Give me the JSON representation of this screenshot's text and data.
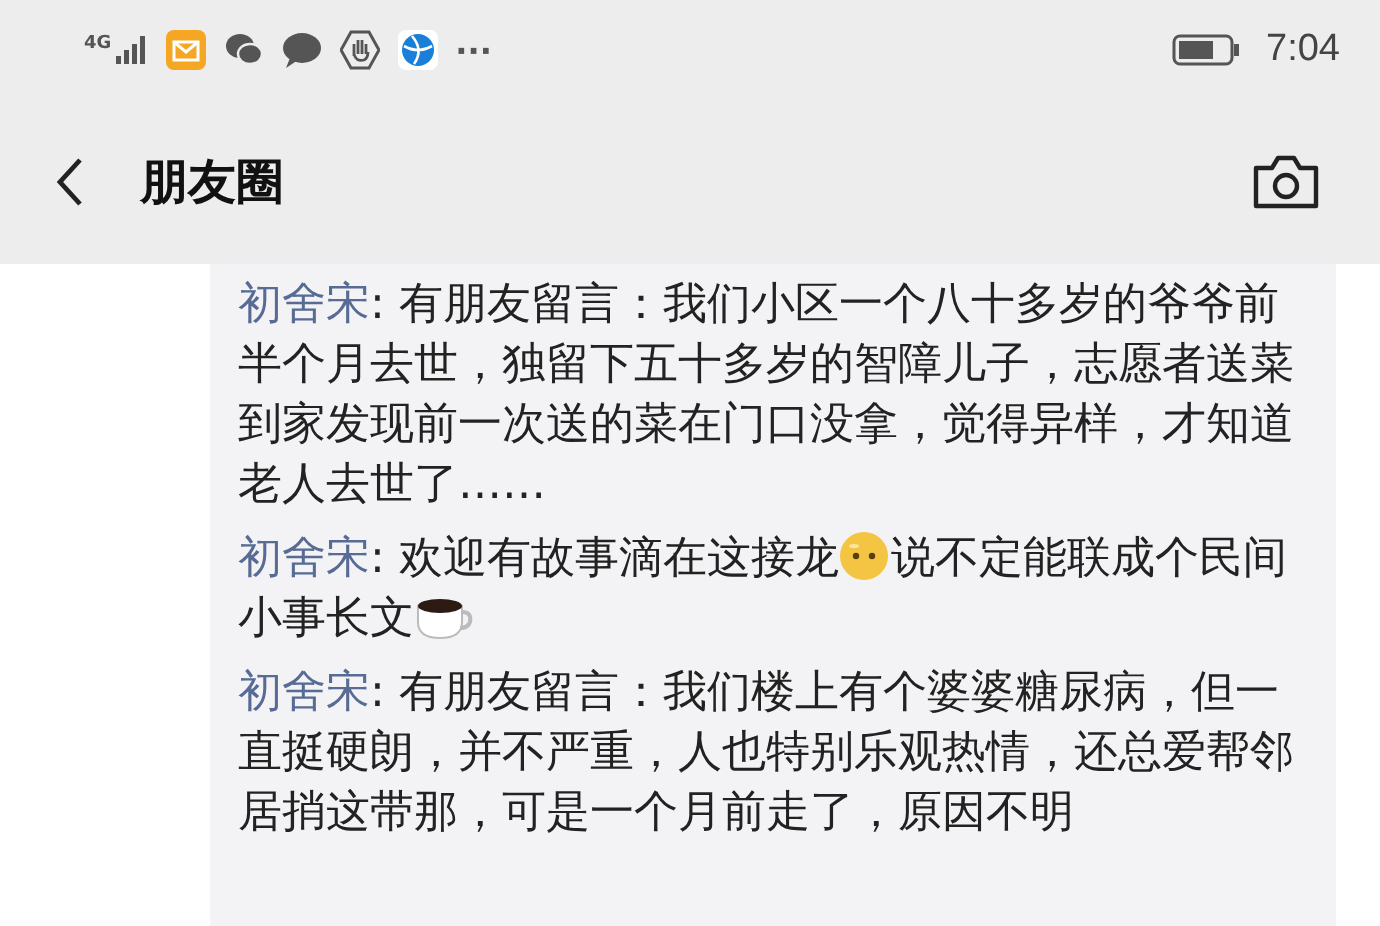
{
  "status_bar": {
    "network": "4G",
    "notifications": [
      {
        "kind": "mail"
      },
      {
        "kind": "wechat"
      },
      {
        "kind": "chat"
      },
      {
        "kind": "hand"
      },
      {
        "kind": "globe"
      }
    ],
    "more": "···",
    "time": "7:04"
  },
  "header": {
    "title": "朋友圈"
  },
  "comments": [
    {
      "author": "初舍宋",
      "parts": [
        {
          "kind": "text",
          "text": ": 有朋友留言：我们小区一个八十多岁的爷爷前半个月去世，独留下五十多岁的智障儿子，志愿者送菜到家发现前一次送的菜在门口没拿，觉得异样，才知道老人去世了……"
        }
      ]
    },
    {
      "author": "初舍宋",
      "parts": [
        {
          "kind": "text",
          "text": ": 欢迎有故事滴在这接龙"
        },
        {
          "kind": "face"
        },
        {
          "kind": "text",
          "text": "说不定能联成个民间小事长文"
        },
        {
          "kind": "coffee"
        }
      ]
    },
    {
      "author": "初舍宋",
      "parts": [
        {
          "kind": "text",
          "text": ": 有朋友留言：我们楼上有个婆婆糖尿病，但一直挺硬朗，并不严重，人也特别乐观热情，还总爱帮邻居捎这带那，可是一个月前走了，原因不明"
        }
      ]
    }
  ]
}
